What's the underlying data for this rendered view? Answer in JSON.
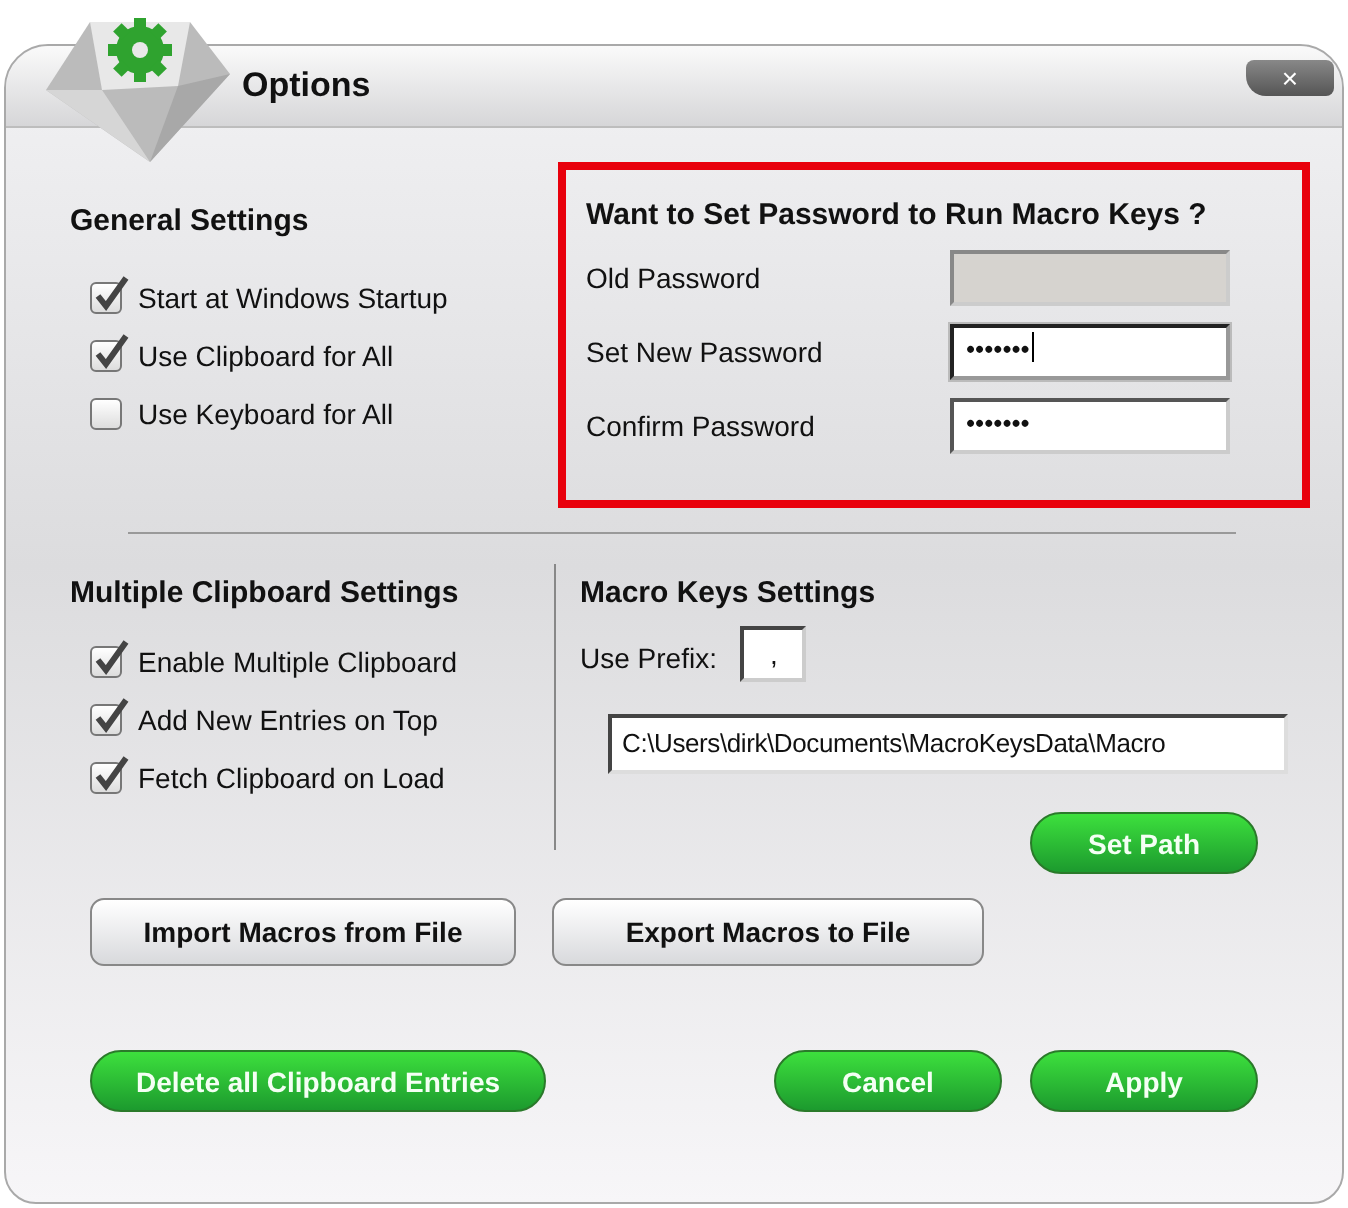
{
  "window": {
    "title": "Options",
    "close": "×"
  },
  "general": {
    "title": "General Settings",
    "options": [
      {
        "label": "Start at Windows Startup",
        "checked": true
      },
      {
        "label": "Use Clipboard for All",
        "checked": true
      },
      {
        "label": "Use Keyboard for All",
        "checked": false
      }
    ]
  },
  "password": {
    "title": "Want to Set Password to Run Macro Keys ?",
    "fields": [
      {
        "label": "Old Password",
        "disabled": true,
        "focused": false
      },
      {
        "label": "Set New Password",
        "value": "•••••••",
        "disabled": false,
        "focused": true
      },
      {
        "label": "Confirm Password",
        "value": "•••••••",
        "disabled": false,
        "focused": false
      }
    ]
  },
  "clipboard": {
    "title": "Multiple Clipboard Settings",
    "options": [
      {
        "label": "Enable Multiple Clipboard",
        "checked": true
      },
      {
        "label": "Add New Entries on Top",
        "checked": true
      },
      {
        "label": "Fetch Clipboard on Load",
        "checked": true
      }
    ]
  },
  "macro": {
    "title": "Macro Keys Settings",
    "prefix_label": "Use Prefix:",
    "prefix": ",",
    "path": "C:\\Users\\dirk\\Documents\\MacroKeysData\\Macro",
    "set_path": "Set Path"
  },
  "file_buttons": [
    "Import Macros from File",
    "Export Macros to File"
  ],
  "footer": {
    "delete": "Delete all Clipboard Entries",
    "buttons": [
      "Cancel",
      "Apply"
    ]
  }
}
